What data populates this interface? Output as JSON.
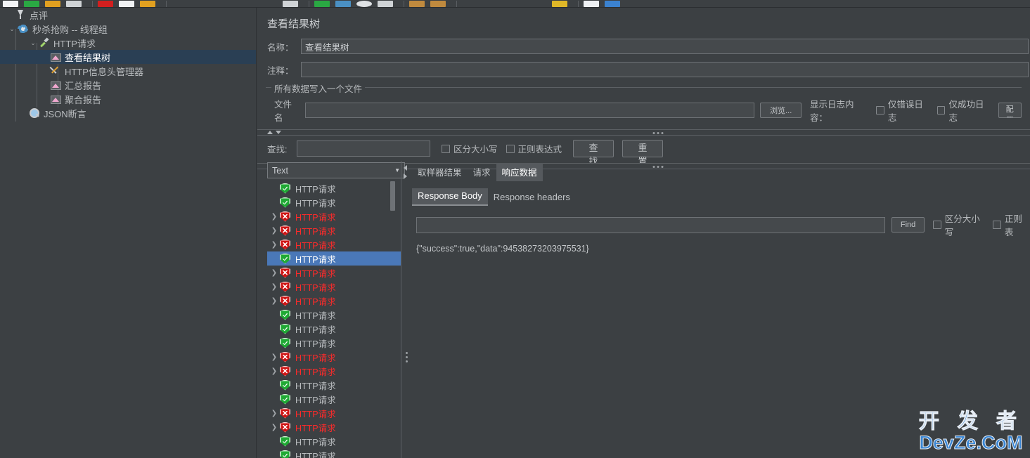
{
  "toolbar": {
    "icons": [
      "new-icon",
      "open-icon",
      "save-icon",
      "cut-icon",
      "copy-icon",
      "paste-icon",
      "expand-icon",
      "collapse-icon",
      "toggle-icon",
      "start-icon",
      "start-no-pause-icon",
      "stop-icon",
      "shutdown-icon",
      "clear-icon",
      "clear-all-icon",
      "search-icon",
      "reset-search-icon",
      "function-helper-icon",
      "help-icon",
      "remote-icon"
    ]
  },
  "tree": {
    "items": [
      {
        "label": "点评",
        "icon": "test-plan-icon",
        "indent": 0,
        "twisty": "",
        "selected": false
      },
      {
        "label": "秒杀抢购 -- 线程组",
        "icon": "thread-group-icon",
        "indent": 1,
        "twisty": "expanded",
        "selected": false
      },
      {
        "label": "HTTP请求",
        "icon": "http-sampler-icon",
        "indent": 2,
        "twisty": "expanded",
        "selected": false
      },
      {
        "label": "查看结果树",
        "icon": "view-results-tree-icon",
        "indent": 3,
        "twisty": "",
        "selected": true
      },
      {
        "label": "HTTP信息头管理器",
        "icon": "header-manager-icon",
        "indent": 3,
        "twisty": "",
        "selected": false
      },
      {
        "label": "汇总报告",
        "icon": "summary-report-icon",
        "indent": 3,
        "twisty": "",
        "selected": false
      },
      {
        "label": "聚合报告",
        "icon": "aggregate-report-icon",
        "indent": 3,
        "twisty": "",
        "selected": false
      },
      {
        "label": "JSON断言",
        "icon": "json-assertion-icon",
        "indent": 2,
        "twisty": "",
        "selected": false
      }
    ]
  },
  "main": {
    "title": "查看结果树",
    "name_label": "名称：",
    "name_value": "查看结果树",
    "comment_label": "注释：",
    "comment_value": "",
    "group_legend": "所有数据写入一个文件",
    "filename_label": "文件名",
    "filename_value": "",
    "browse_button": "浏览...",
    "log_display_label": "显示日志内容：",
    "only_error_log": "仅错误日志",
    "only_success_log": "仅成功日志",
    "configure_button": "配置",
    "search_label": "查找:",
    "search_value": "",
    "case_sensitive": "区分大小写",
    "regex": "正则表达式",
    "find_button": "查找",
    "reset_button": "重置"
  },
  "results": {
    "render_selected": "Text",
    "render_options": [
      "Text"
    ],
    "rows": [
      {
        "label": "HTTP请求",
        "status": "ok",
        "expandable": false
      },
      {
        "label": "HTTP请求",
        "status": "ok",
        "expandable": false
      },
      {
        "label": "HTTP请求",
        "status": "err",
        "expandable": true
      },
      {
        "label": "HTTP请求",
        "status": "err",
        "expandable": true
      },
      {
        "label": "HTTP请求",
        "status": "err",
        "expandable": true
      },
      {
        "label": "HTTP请求",
        "status": "ok",
        "expandable": false,
        "selected": true
      },
      {
        "label": "HTTP请求",
        "status": "err",
        "expandable": true
      },
      {
        "label": "HTTP请求",
        "status": "err",
        "expandable": true
      },
      {
        "label": "HTTP请求",
        "status": "err",
        "expandable": true
      },
      {
        "label": "HTTP请求",
        "status": "ok",
        "expandable": false
      },
      {
        "label": "HTTP请求",
        "status": "ok",
        "expandable": false
      },
      {
        "label": "HTTP请求",
        "status": "ok",
        "expandable": false
      },
      {
        "label": "HTTP请求",
        "status": "err",
        "expandable": true
      },
      {
        "label": "HTTP请求",
        "status": "err",
        "expandable": true
      },
      {
        "label": "HTTP请求",
        "status": "ok",
        "expandable": false
      },
      {
        "label": "HTTP请求",
        "status": "ok",
        "expandable": false
      },
      {
        "label": "HTTP请求",
        "status": "err",
        "expandable": true
      },
      {
        "label": "HTTP请求",
        "status": "err",
        "expandable": true
      },
      {
        "label": "HTTP请求",
        "status": "ok",
        "expandable": false
      },
      {
        "label": "HTTP请求",
        "status": "ok",
        "expandable": false
      }
    ]
  },
  "detail": {
    "tabs": [
      {
        "label": "取样器结果",
        "active": false
      },
      {
        "label": "请求",
        "active": false
      },
      {
        "label": "响应数据",
        "active": true
      }
    ],
    "subtabs": [
      {
        "label": "Response Body",
        "active": true
      },
      {
        "label": "Response headers",
        "active": false
      }
    ],
    "find_value": "",
    "find_button": "Find",
    "case_sensitive": "区分大小写",
    "regex": "正则表",
    "body_text": "{\"success\":true,\"data\":94538273203975531}"
  },
  "watermark": {
    "line1": "开 发 者",
    "line2": "DevZe.CoM"
  },
  "colors": {
    "bg": "#3c4043",
    "selection": "#4a78b8",
    "tree_selection": "#2a3f54",
    "error_text": "#ff2a2a",
    "success_shield": "#1faa34",
    "error_shield": "#cf1515",
    "watermark": "#3a86d4"
  }
}
